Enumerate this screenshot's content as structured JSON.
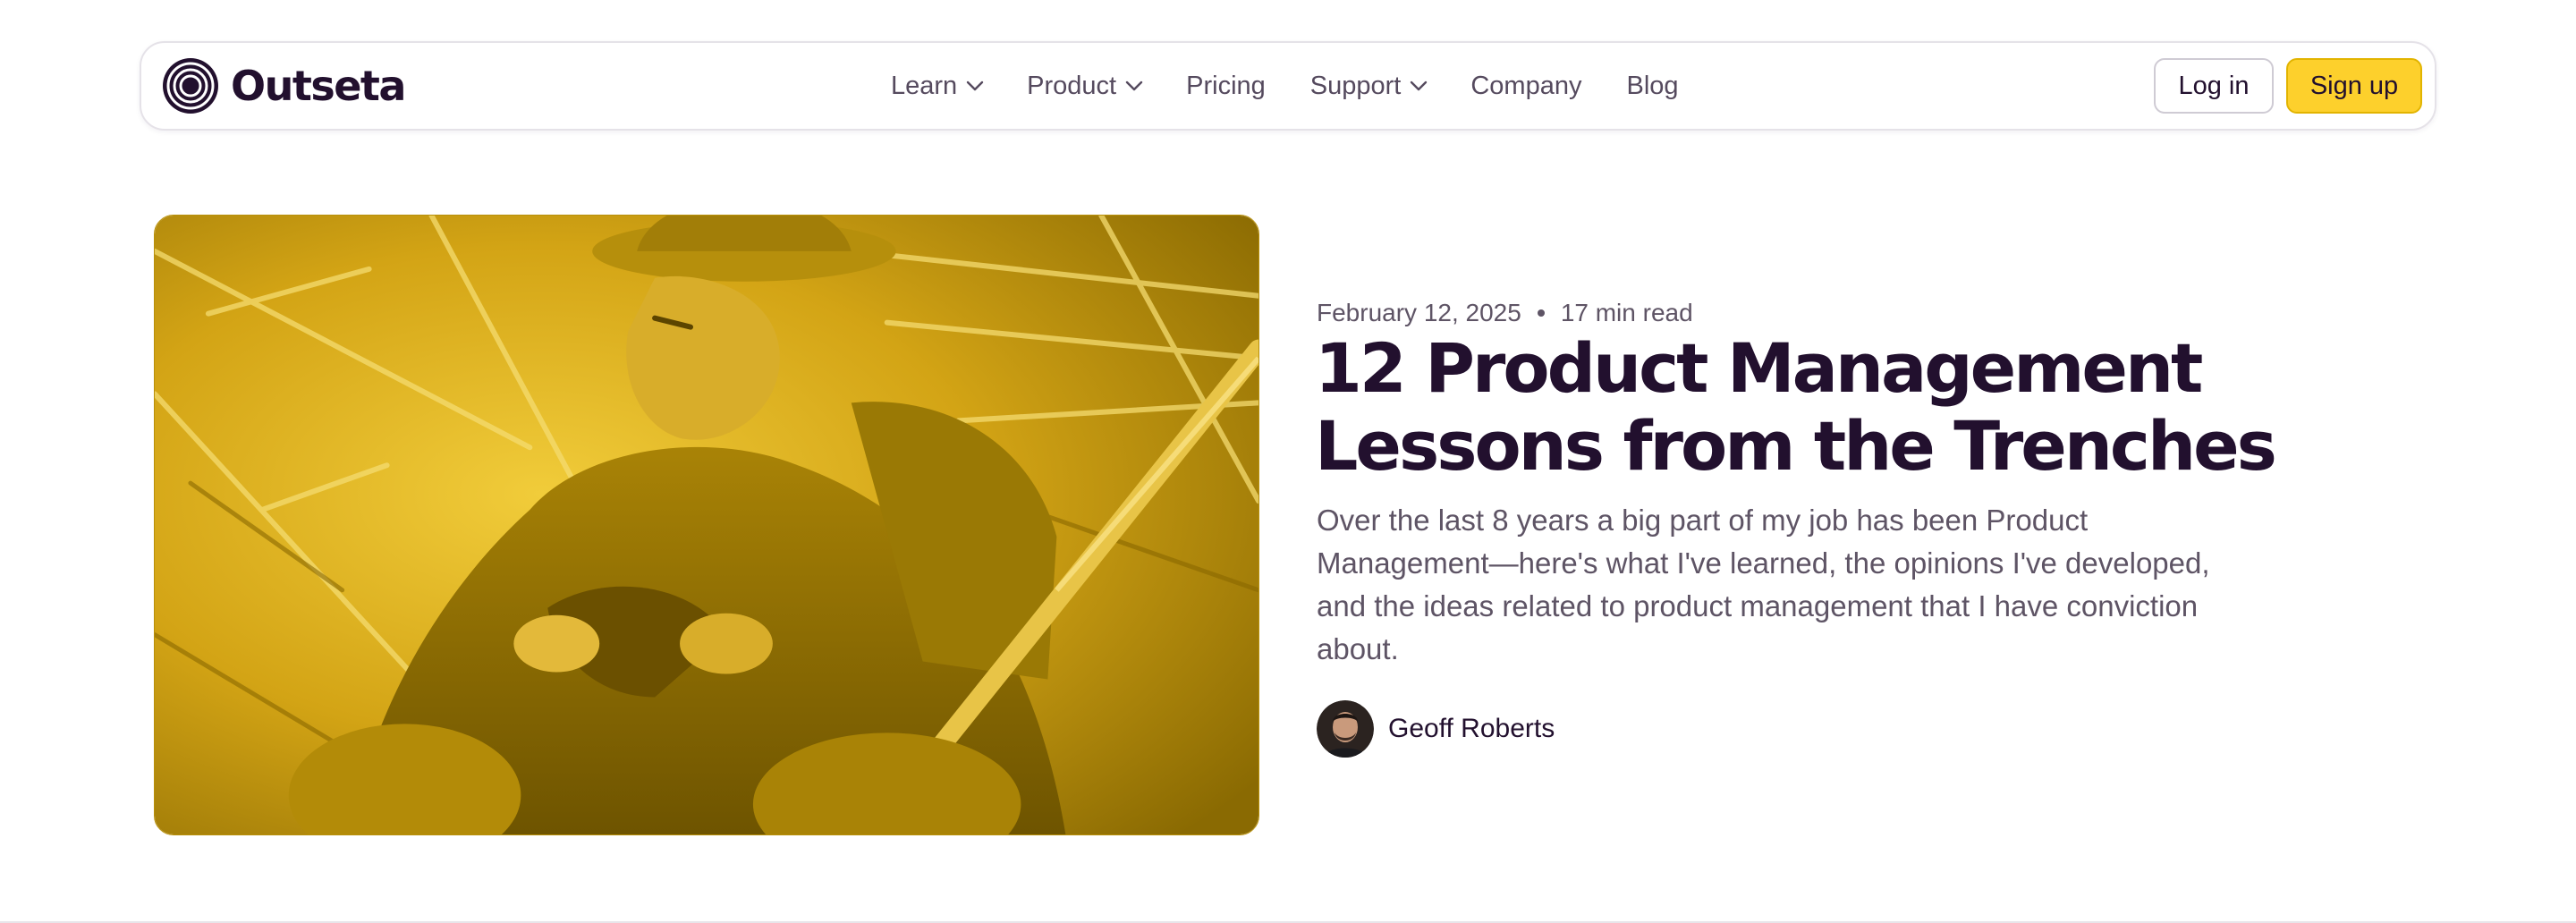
{
  "brand": {
    "name": "Outseta",
    "logo_icon": "concentric-rings-logo-icon"
  },
  "nav": {
    "items": [
      {
        "label": "Learn",
        "has_dropdown": true
      },
      {
        "label": "Product",
        "has_dropdown": true
      },
      {
        "label": "Pricing",
        "has_dropdown": false
      },
      {
        "label": "Support",
        "has_dropdown": true
      },
      {
        "label": "Company",
        "has_dropdown": false
      },
      {
        "label": "Blog",
        "has_dropdown": false
      }
    ],
    "login_label": "Log in",
    "signup_label": "Sign up"
  },
  "article": {
    "date": "February 12, 2025",
    "read_time": "17 min read",
    "title": "12 Product Management Lessons from the Trenches",
    "excerpt": "Over the last 8 years a big part of my job has been Product Management—here's what I've learned, the opinions I've developed, and the ideas related to product management that I have conviction about.",
    "author": "Geoff Roberts",
    "image_icon": "soldier-reading-photo"
  },
  "colors": {
    "brand_dark": "#22102e",
    "accent_yellow": "#fdd02c",
    "muted_text": "#5e5465",
    "photo_tint": "#c79a0e"
  }
}
